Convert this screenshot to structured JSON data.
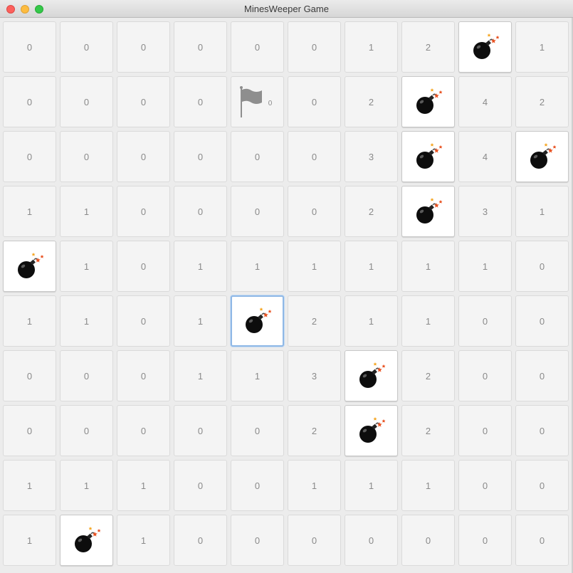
{
  "window": {
    "title": "MinesWeeper Game"
  },
  "colors": {
    "mine_cell_bg": "#ffffff",
    "cell_bg": "#f4f4f4",
    "number_text": "#8a8a8a",
    "focus_ring": "#8fb8e6",
    "flag": "#8e8e8e"
  },
  "focused_cell": [
    5,
    4
  ],
  "board": [
    [
      "0",
      "0",
      "0",
      "0",
      "0",
      "0",
      "1",
      "2",
      "M",
      "1"
    ],
    [
      "0",
      "0",
      "0",
      "0",
      "F0",
      "0",
      "2",
      "M",
      "4",
      "2"
    ],
    [
      "0",
      "0",
      "0",
      "0",
      "0",
      "0",
      "3",
      "M",
      "4",
      "M"
    ],
    [
      "1",
      "1",
      "0",
      "0",
      "0",
      "0",
      "2",
      "M",
      "3",
      "1"
    ],
    [
      "M",
      "1",
      "0",
      "1",
      "1",
      "1",
      "1",
      "1",
      "1",
      "0"
    ],
    [
      "1",
      "1",
      "0",
      "1",
      "M",
      "2",
      "1",
      "1",
      "0",
      "0"
    ],
    [
      "0",
      "0",
      "0",
      "1",
      "1",
      "3",
      "M",
      "2",
      "0",
      "0"
    ],
    [
      "0",
      "0",
      "0",
      "0",
      "0",
      "2",
      "M",
      "2",
      "0",
      "0"
    ],
    [
      "1",
      "1",
      "1",
      "0",
      "0",
      "1",
      "1",
      "1",
      "0",
      "0"
    ],
    [
      "1",
      "M",
      "1",
      "0",
      "0",
      "0",
      "0",
      "0",
      "0",
      "0"
    ]
  ],
  "icons": {
    "mine": "bomb-icon",
    "flag": "flag-icon"
  }
}
